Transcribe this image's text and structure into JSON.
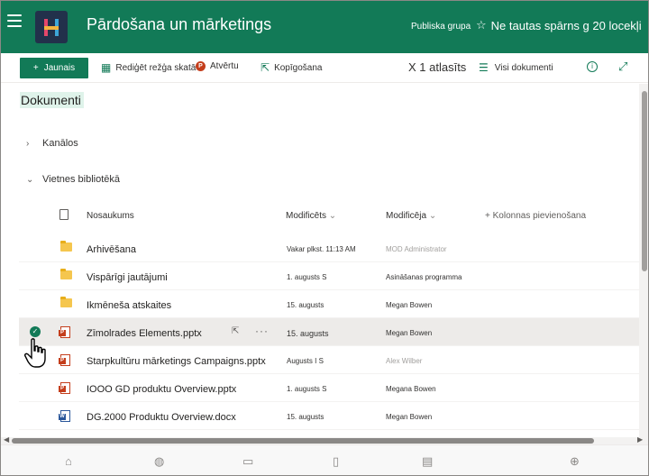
{
  "header": {
    "site_title": "Pārdošana un mārketings",
    "site_type": "Publiska grupa",
    "follow_label": "Ne tautas spārns g 20 locekļi"
  },
  "command_bar": {
    "new_label": "Jaunais",
    "edit_grid_label": "Rediģēt režģa skatā",
    "open_label": "Atvērtu",
    "share_label": "Kopīgošana",
    "selected_label": "X 1 atlasīts",
    "view_label": "Visi dokumenti"
  },
  "library": {
    "title": "Dokumenti",
    "groups": [
      "Kanālos",
      "Vietnes bibliotēkā"
    ],
    "columns": {
      "name": "Nosaukums",
      "modified": "Modificēts",
      "modified_by": "Modificēja",
      "add_column": "Kolonnas pievienošana"
    },
    "rows": [
      {
        "type": "folder",
        "name": "Arhivēšana",
        "modified": "Vakar plkst.  11:13 AM",
        "modified_by": "MOD Administrator",
        "selected": false
      },
      {
        "type": "folder",
        "name": "Vispārīgi jautājumi",
        "modified": "1. augusts S",
        "modified_by": "Asināšanas programma",
        "selected": false
      },
      {
        "type": "folder",
        "name": "Ikmēneša atskaites",
        "modified": "15. augusts",
        "modified_by": "Megan Bowen",
        "selected": false
      },
      {
        "type": "pptx",
        "name": "Zīmolrades Elements.pptx",
        "modified": "15. augusts",
        "modified_by": "Megan Bowen",
        "selected": true
      },
      {
        "type": "pptx",
        "name": "Starpkultūru mārketings Campaigns.pptx",
        "modified": "Augusts I S",
        "modified_by": "Alex Wilber",
        "selected": false
      },
      {
        "type": "pptx",
        "name": "IOOO GD produktu Overview.pptx",
        "modified": "1. augusts S",
        "modified_by": "Megana Bowen",
        "selected": false
      },
      {
        "type": "docx",
        "name": "DG.2000 Produktu Overview.docx",
        "modified": "15. augusts",
        "modified_by": "Megan Bowen",
        "selected": false
      }
    ]
  },
  "colors": {
    "brand": "#127a57",
    "selected_row": "#edebe9"
  },
  "icons": {
    "menu": "hamburger-icon",
    "follow": "star-icon",
    "bottom_nav": [
      "home-icon",
      "globe-icon",
      "news-icon",
      "file-icon",
      "list-icon",
      "add-icon"
    ]
  }
}
